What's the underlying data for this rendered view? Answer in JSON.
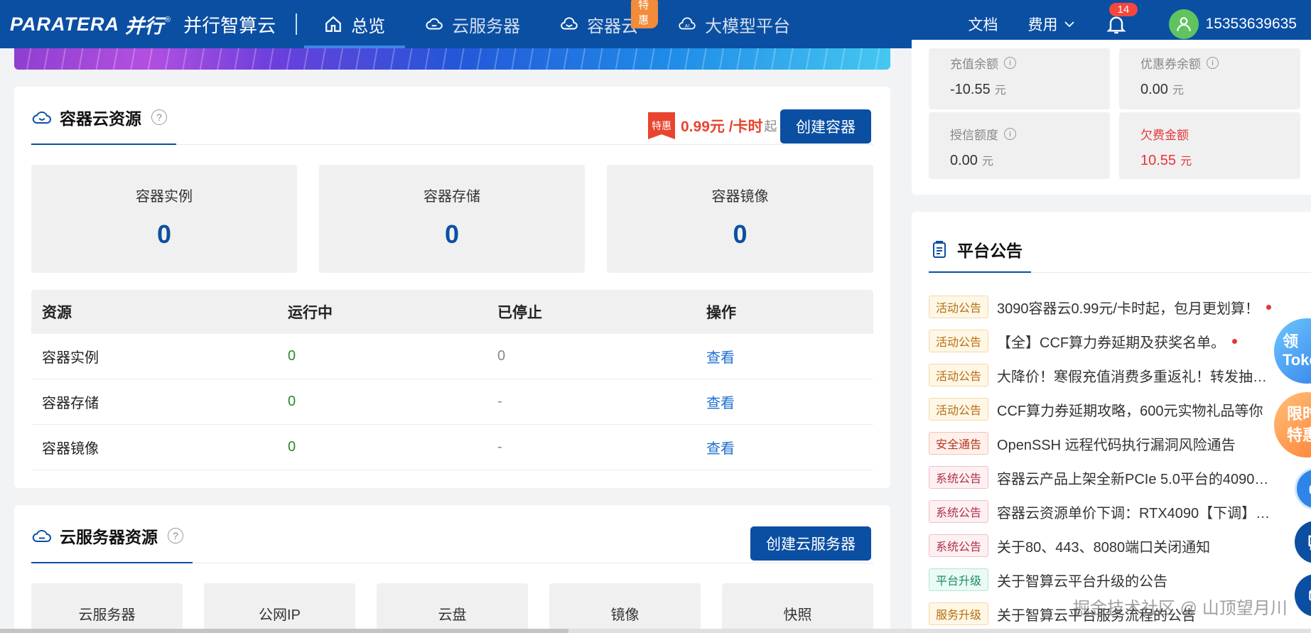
{
  "brand": {
    "logo_en": "PARATERA",
    "logo_cn": "并行",
    "reg": "®",
    "product": "并行智算云"
  },
  "nav": {
    "items": [
      {
        "label": "总览",
        "icon": "home-icon",
        "active": true
      },
      {
        "label": "云服务器",
        "icon": "cloud-icon"
      },
      {
        "label": "容器云",
        "icon": "container-cloud-icon",
        "badge": "特惠"
      },
      {
        "label": "大模型平台",
        "icon": "ai-icon"
      }
    ],
    "docs": "文档",
    "billing": "费用",
    "bell_count": "14",
    "user": "15353639635"
  },
  "container": {
    "title": "容器云资源",
    "help": "?",
    "promo_tag": "特惠",
    "promo_price": "0.99元 /卡时",
    "promo_suffix": "起",
    "create_btn": "创建容器",
    "stats": [
      {
        "label": "容器实例",
        "value": "0"
      },
      {
        "label": "容器存储",
        "value": "0"
      },
      {
        "label": "容器镜像",
        "value": "0"
      }
    ],
    "table": {
      "headers": [
        "资源",
        "运行中",
        "已停止",
        "操作"
      ],
      "rows": [
        {
          "name": "容器实例",
          "running": "0",
          "stopped": "0",
          "action": "查看"
        },
        {
          "name": "容器存储",
          "running": "0",
          "stopped": "-",
          "action": "查看"
        },
        {
          "name": "容器镜像",
          "running": "0",
          "stopped": "-",
          "action": "查看"
        }
      ]
    }
  },
  "server": {
    "title": "云服务器资源",
    "help": "?",
    "create_btn": "创建云服务器",
    "stats": [
      "云服务器",
      "公网IP",
      "云盘",
      "镜像",
      "快照"
    ]
  },
  "balance": {
    "items": [
      {
        "label": "充值余额",
        "value": "-10.55",
        "unit": "元",
        "info": "i"
      },
      {
        "label": "优惠券余额",
        "value": "0.00",
        "unit": "元",
        "info": "i"
      },
      {
        "label": "授信额度",
        "value": "0.00",
        "unit": "元",
        "info": "i"
      },
      {
        "label": "欠费金额",
        "value": "10.55",
        "unit": "元"
      }
    ]
  },
  "notices": {
    "title": "平台公告",
    "items": [
      {
        "tag": "活动公告",
        "type": "act",
        "text": "3090容器云0.99元/卡时起，包月更划算！",
        "dot": true
      },
      {
        "tag": "活动公告",
        "type": "act",
        "text": "【全】CCF算力券延期及获奖名单。",
        "dot": true
      },
      {
        "tag": "活动公告",
        "type": "act",
        "text": "大降价！寒假充值消费多重返礼！转发抽…"
      },
      {
        "tag": "活动公告",
        "type": "act",
        "text": "CCF算力券延期攻略，600元实物礼品等你"
      },
      {
        "tag": "安全通告",
        "type": "sec",
        "text": "OpenSSH 远程代码执行漏洞风险通告"
      },
      {
        "tag": "系统公告",
        "type": "sys",
        "text": "容器云产品上架全新PCIe 5.0平台的4090…"
      },
      {
        "tag": "系统公告",
        "type": "sys",
        "text": "容器云资源单价下调：RTX4090【下调】…"
      },
      {
        "tag": "系统公告",
        "type": "sys",
        "text": "关于80、443、8080端口关闭通知"
      },
      {
        "tag": "平台升级",
        "type": "plat",
        "text": "关于智算云平台升级的公告"
      },
      {
        "tag": "服务升级",
        "type": "srv",
        "text": "关于智算云平台服务流程的公告"
      }
    ]
  },
  "floats": {
    "token_line1": "领",
    "token_line2": "Toke",
    "promo_line1": "限时",
    "promo_line2": "特惠"
  },
  "watermark": "掘金技术社区 @ 山顶望月川",
  "colors": {
    "brand": "#0b4fa3",
    "accent_red": "#e8343a",
    "green": "#2c8a2c"
  }
}
